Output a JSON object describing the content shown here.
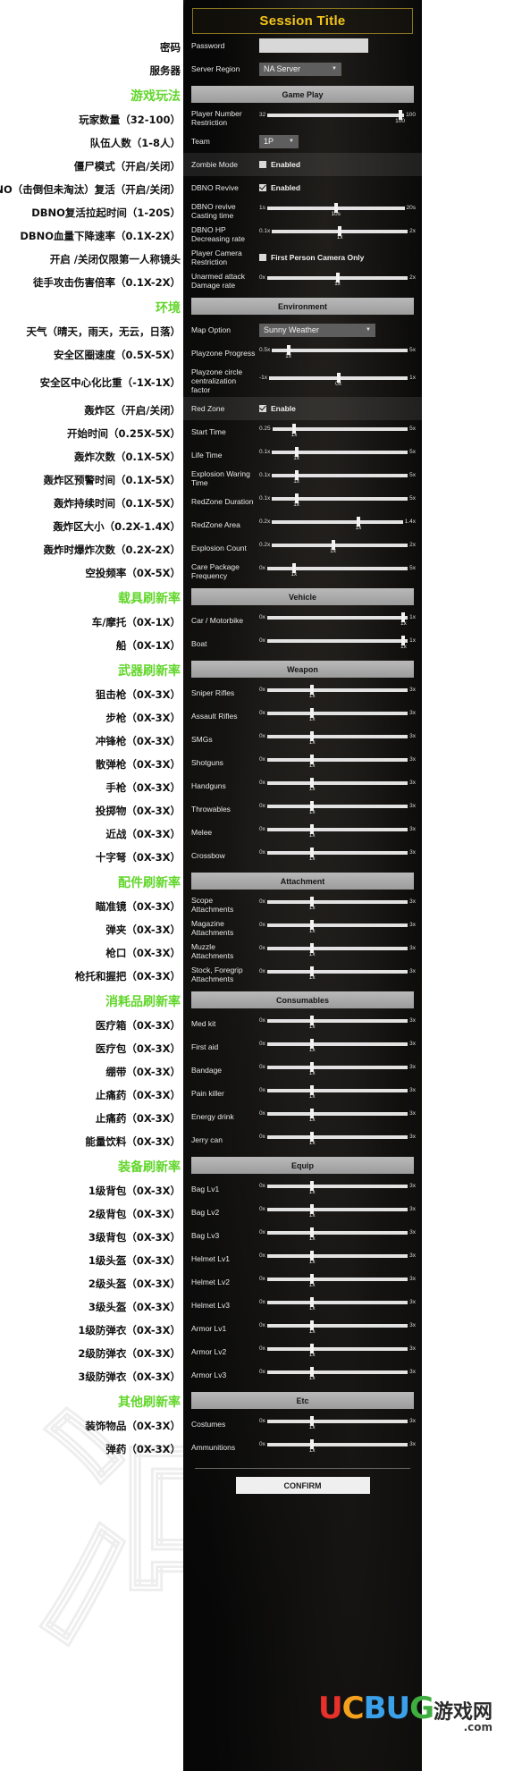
{
  "session": {
    "title": "Session Title"
  },
  "top": {
    "password": {
      "cn": "密码",
      "label": "Password",
      "value": "",
      "placeholder": ""
    },
    "server_region": {
      "cn": "服务器",
      "label": "Server Region",
      "value": "NA Server"
    }
  },
  "sections": [
    {
      "id": "gameplay",
      "cn_header": "游戏玩法",
      "bar": "Game Play",
      "rows": [
        {
          "type": "slider",
          "cn": "玩家数量（32-100）",
          "label": "Player Number Restriction",
          "min": "32",
          "max": "100",
          "value": "100",
          "pct": 97
        },
        {
          "type": "dropdown",
          "cn": "队伍人数（1-8人）",
          "label": "Team",
          "value": "1P"
        },
        {
          "type": "checkbox",
          "cn": "僵尸模式（开启/关闭）",
          "label": "Zombie Mode",
          "check_label": "Enabled",
          "checked": false,
          "highlight": true
        },
        {
          "type": "checkbox",
          "cn": "DBNO（击倒但未淘汰）复活（开启/关闭）",
          "label": "DBNO Revive",
          "check_label": "Enabled",
          "checked": true
        },
        {
          "type": "slider",
          "cn": "DBNO复活拉起时间（1-20S）",
          "label": "DBNO revive Casting time",
          "min": "1s",
          "max": "20s",
          "value": "10s",
          "pct": 50
        },
        {
          "type": "slider",
          "cn": "DBNO血量下降速率（0.1X-2X）",
          "label": "DBNO HP Decreasing rate",
          "min": "0.1x",
          "max": "2x",
          "value": "1x",
          "pct": 50
        },
        {
          "type": "checkbox",
          "cn": "开启 /关闭仅限第一人称镜头",
          "label": "Player Camera Restriction",
          "check_label": "First Person Camera Only",
          "checked": false
        },
        {
          "type": "slider",
          "cn": "徒手攻击伤害倍率（0.1X-2X）",
          "label": "Unarmed attack Damage rate",
          "min": "0x",
          "max": "2x",
          "value": "1x",
          "pct": 50
        }
      ]
    },
    {
      "id": "environment",
      "cn_header": "环境",
      "bar": "Environment",
      "rows": [
        {
          "type": "dropdown",
          "cn": "天气（晴天，雨天，无云，日落）",
          "label": "Map Option",
          "value": "Sunny Weather",
          "wide": true
        },
        {
          "type": "slider",
          "cn": "安全区圈速度（0.5X-5X）",
          "label": "Playzone Progress",
          "min": "0.5x",
          "max": "5x",
          "value": "1x",
          "pct": 12
        },
        {
          "type": "slider",
          "cn": "安全区中心化比重（-1X-1X）",
          "label": "Playzone circle centralization factor",
          "min": "-1x",
          "max": "1x",
          "value": "0x",
          "pct": 50
        },
        {
          "type": "checkbox",
          "cn": "轰炸区（开启/关闭）",
          "label": "Red Zone",
          "check_label": "Enable",
          "checked": true,
          "highlight": true
        },
        {
          "type": "slider",
          "cn": "开始时间（0.25X-5X）",
          "label": "Start Time",
          "min": "0.25",
          "max": "5x",
          "value": "1x",
          "pct": 16
        },
        {
          "type": "slider",
          "cn": "轰炸次数（0.1X-5X）",
          "label": "Life Time",
          "min": "0.1x",
          "max": "5x",
          "value": "1x",
          "pct": 18
        },
        {
          "type": "slider",
          "cn": "轰炸区预警时间（0.1X-5X）",
          "label": "Explosion Waring Time",
          "min": "0.1x",
          "max": "5x",
          "value": "1x",
          "pct": 18
        },
        {
          "type": "slider",
          "cn": "轰炸持续时间（0.1X-5X）",
          "label": "RedZone Duration",
          "min": "0.1x",
          "max": "5x",
          "value": "1x",
          "pct": 18
        },
        {
          "type": "slider",
          "cn": "轰炸区大小（0.2X-1.4X）",
          "label": "RedZone Area",
          "min": "0.2x",
          "max": "1.4x",
          "value": "1x",
          "pct": 66
        },
        {
          "type": "slider",
          "cn": "轰炸时爆炸次数（0.2X-2X）",
          "label": "Explosion Count",
          "min": "0.2x",
          "max": "2x",
          "value": "1x",
          "pct": 45
        },
        {
          "type": "slider",
          "cn": "空投频率（0X-5X）",
          "label": "Care Package Frequency",
          "min": "0x",
          "max": "5x",
          "value": "1x",
          "pct": 19
        }
      ]
    },
    {
      "id": "vehicle",
      "cn_header": "载具刷新率",
      "bar": "Vehicle",
      "rows": [
        {
          "type": "slider",
          "cn": "车/摩托（0X-1X）",
          "label": "Car / Motorbike",
          "min": "0x",
          "max": "1x",
          "value": "1x",
          "pct": 97
        },
        {
          "type": "slider",
          "cn": "船（0X-1X）",
          "label": "Boat",
          "min": "0x",
          "max": "1x",
          "value": "1x",
          "pct": 97
        }
      ]
    },
    {
      "id": "weapon",
      "cn_header": "武器刷新率",
      "bar": "Weapon",
      "rows": [
        {
          "type": "slider",
          "cn": "狙击枪（0X-3X）",
          "label": "Sniper Rifles",
          "min": "0x",
          "max": "3x",
          "value": "1x",
          "pct": 32
        },
        {
          "type": "slider",
          "cn": "步枪（0X-3X）",
          "label": "Assault Rifles",
          "min": "0x",
          "max": "3x",
          "value": "1x",
          "pct": 32
        },
        {
          "type": "slider",
          "cn": "冲锋枪（0X-3X）",
          "label": "SMGs",
          "min": "0x",
          "max": "3x",
          "value": "1x",
          "pct": 32
        },
        {
          "type": "slider",
          "cn": "散弹枪（0X-3X）",
          "label": "Shotguns",
          "min": "0x",
          "max": "3x",
          "value": "1x",
          "pct": 32
        },
        {
          "type": "slider",
          "cn": "手枪（0X-3X）",
          "label": "Handguns",
          "min": "0x",
          "max": "3x",
          "value": "1x",
          "pct": 32
        },
        {
          "type": "slider",
          "cn": "投掷物（0X-3X）",
          "label": "Throwables",
          "min": "0x",
          "max": "3x",
          "value": "1x",
          "pct": 32
        },
        {
          "type": "slider",
          "cn": "近战（0X-3X）",
          "label": "Melee",
          "min": "0x",
          "max": "3x",
          "value": "1x",
          "pct": 32
        },
        {
          "type": "slider",
          "cn": "十字弩（0X-3X）",
          "label": "Crossbow",
          "min": "0x",
          "max": "3x",
          "value": "1x",
          "pct": 32
        }
      ]
    },
    {
      "id": "attachment",
      "cn_header": "配件刷新率",
      "bar": "Attachment",
      "rows": [
        {
          "type": "slider",
          "cn": "瞄准镜（0X-3X）",
          "label": "Scope Attachments",
          "min": "0x",
          "max": "3x",
          "value": "1x",
          "pct": 32
        },
        {
          "type": "slider",
          "cn": "弹夹（0X-3X）",
          "label": "Magazine Attachments",
          "min": "0x",
          "max": "3x",
          "value": "1x",
          "pct": 32
        },
        {
          "type": "slider",
          "cn": "枪口（0X-3X）",
          "label": "Muzzle Attachments",
          "min": "0x",
          "max": "3x",
          "value": "1x",
          "pct": 32
        },
        {
          "type": "slider",
          "cn": "枪托和握把（0X-3X）",
          "label": "Stock, Foregrip Attachments",
          "min": "0x",
          "max": "3x",
          "value": "1x",
          "pct": 32
        }
      ]
    },
    {
      "id": "consumables",
      "cn_header": "消耗品刷新率",
      "bar": "Consumables",
      "rows": [
        {
          "type": "slider",
          "cn": "医疗箱（0X-3X）",
          "label": "Med kit",
          "min": "0x",
          "max": "3x",
          "value": "1x",
          "pct": 32
        },
        {
          "type": "slider",
          "cn": "医疗包（0X-3X）",
          "label": "First aid",
          "min": "0x",
          "max": "3x",
          "value": "1x",
          "pct": 32
        },
        {
          "type": "slider",
          "cn": "绷带（0X-3X）",
          "label": "Bandage",
          "min": "0x",
          "max": "3x",
          "value": "1x",
          "pct": 32
        },
        {
          "type": "slider",
          "cn": "止痛药（0X-3X）",
          "label": "Pain killer",
          "min": "0x",
          "max": "3x",
          "value": "1x",
          "pct": 32
        },
        {
          "type": "slider",
          "cn": "止痛药（0X-3X）",
          "label": "Energy drink",
          "min": "0x",
          "max": "3x",
          "value": "1x",
          "pct": 32
        },
        {
          "type": "slider",
          "cn": "能量饮料（0X-3X）",
          "label": "Jerry can",
          "min": "0x",
          "max": "3x",
          "value": "1x",
          "pct": 32
        }
      ]
    },
    {
      "id": "equip",
      "cn_header": "装备刷新率",
      "bar": "Equip",
      "rows": [
        {
          "type": "slider",
          "cn": "1级背包（0X-3X）",
          "label": "Bag Lv1",
          "min": "0x",
          "max": "3x",
          "value": "1x",
          "pct": 32
        },
        {
          "type": "slider",
          "cn": "2级背包（0X-3X）",
          "label": "Bag Lv2",
          "min": "0x",
          "max": "3x",
          "value": "1x",
          "pct": 32
        },
        {
          "type": "slider",
          "cn": "3级背包（0X-3X）",
          "label": "Bag Lv3",
          "min": "0x",
          "max": "3x",
          "value": "1x",
          "pct": 32
        },
        {
          "type": "slider",
          "cn": "1级头盔（0X-3X）",
          "label": "Helmet Lv1",
          "min": "0x",
          "max": "3x",
          "value": "1x",
          "pct": 32
        },
        {
          "type": "slider",
          "cn": "2级头盔（0X-3X）",
          "label": "Helmet Lv2",
          "min": "0x",
          "max": "3x",
          "value": "1x",
          "pct": 32
        },
        {
          "type": "slider",
          "cn": "3级头盔（0X-3X）",
          "label": "Helmet Lv3",
          "min": "0x",
          "max": "3x",
          "value": "1x",
          "pct": 32
        },
        {
          "type": "slider",
          "cn": "1级防弹衣（0X-3X）",
          "label": "Armor Lv1",
          "min": "0x",
          "max": "3x",
          "value": "1x",
          "pct": 32
        },
        {
          "type": "slider",
          "cn": "2级防弹衣（0X-3X）",
          "label": "Armor Lv2",
          "min": "0x",
          "max": "3x",
          "value": "1x",
          "pct": 32
        },
        {
          "type": "slider",
          "cn": "3级防弹衣（0X-3X）",
          "label": "Armor Lv3",
          "min": "0x",
          "max": "3x",
          "value": "1x",
          "pct": 32
        }
      ]
    },
    {
      "id": "etc",
      "cn_header": "其他刷新率",
      "bar": "Etc",
      "rows": [
        {
          "type": "slider",
          "cn": "装饰物品（0X-3X）",
          "label": "Costumes",
          "min": "0x",
          "max": "3x",
          "value": "1x",
          "pct": 32
        },
        {
          "type": "slider",
          "cn": "弹药（0X-3X）",
          "label": "Ammunitions",
          "min": "0x",
          "max": "3x",
          "value": "1x",
          "pct": 32
        }
      ]
    }
  ],
  "footer": {
    "confirm_label": "CONFIRM"
  },
  "watermark": {
    "glyph": "冲游"
  },
  "logo": {
    "uc": "UC",
    "bug": "BUG",
    "cn": "游戏网",
    "domain": ".com"
  },
  "colors": {
    "accent_gold": "#f5c518",
    "section_green": "#62d62b",
    "panel_bg": "#0a0a0a",
    "bar_bg": "#b0b0b0"
  }
}
